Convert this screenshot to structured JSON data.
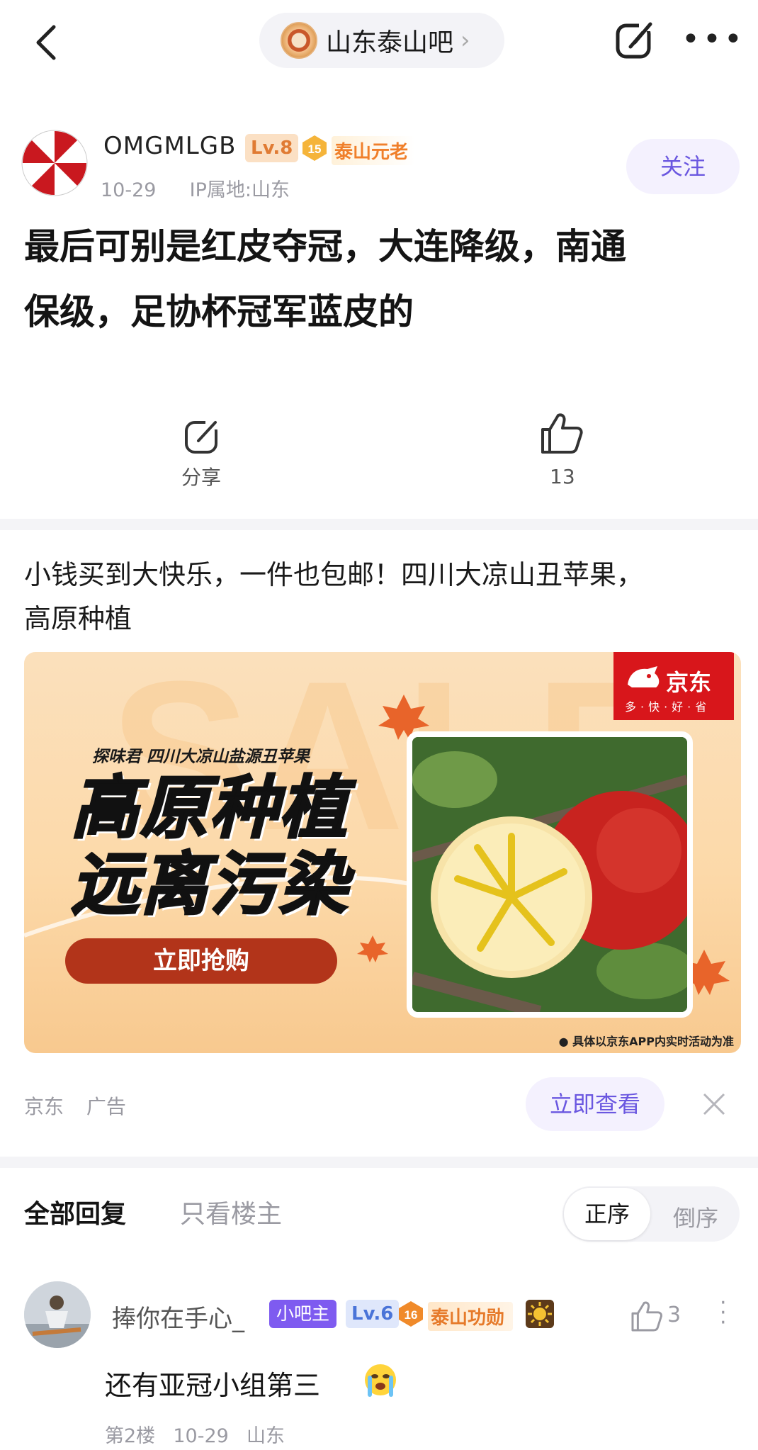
{
  "topbar": {
    "forum_name": "山东泰山吧",
    "back_icon": "back-chevron-icon",
    "edit_icon": "edit-share-icon",
    "more_icon": "more-dots-icon"
  },
  "post": {
    "author": "OMGMLGB",
    "level": "Lv.8",
    "medal_number": "15",
    "honor_title": "泰山元老",
    "date": "10-29",
    "ip": "IP属地:山东",
    "follow_label": "关注",
    "title_line1": "最后可别是红皮夺冠，大连降级，南通",
    "title_line2": "保级，足协杯冠军蓝皮的",
    "share_label": "分享",
    "like_count": "13"
  },
  "ad": {
    "text_line1": "小钱买到大快乐，一件也包邮！四川大凉山丑苹果，",
    "text_line2": "高原种植",
    "banner_tagline": "探味君 四川大凉山盐源丑苹果",
    "banner_head1": "高原种植",
    "banner_head2": "远离污染",
    "banner_button": "立即抢购",
    "brand": "京东",
    "brand_slogan": "多·快·好·省",
    "disclaimer": "● 具体以京东APP内实时活动为准",
    "source": "京东",
    "ad_label": "广告",
    "view_button": "立即查看",
    "close_icon": "close-x-icon"
  },
  "replies": {
    "tab_all": "全部回复",
    "tab_op": "只看楼主",
    "order_asc": "正序",
    "order_desc": "倒序",
    "first": {
      "user": "捧你在手心_",
      "admin_badge": "小吧主",
      "level": "Lv.6",
      "medal_number": "16",
      "honor_title": "泰山功勋",
      "like_count": "3",
      "text": "还有亚冠小组第三",
      "floor": "第2楼",
      "date": "10-29",
      "location": "山东"
    }
  },
  "colors": {
    "accent": "#6a57e0",
    "jd_red": "#d8161b",
    "muted": "#9a9aa2"
  }
}
